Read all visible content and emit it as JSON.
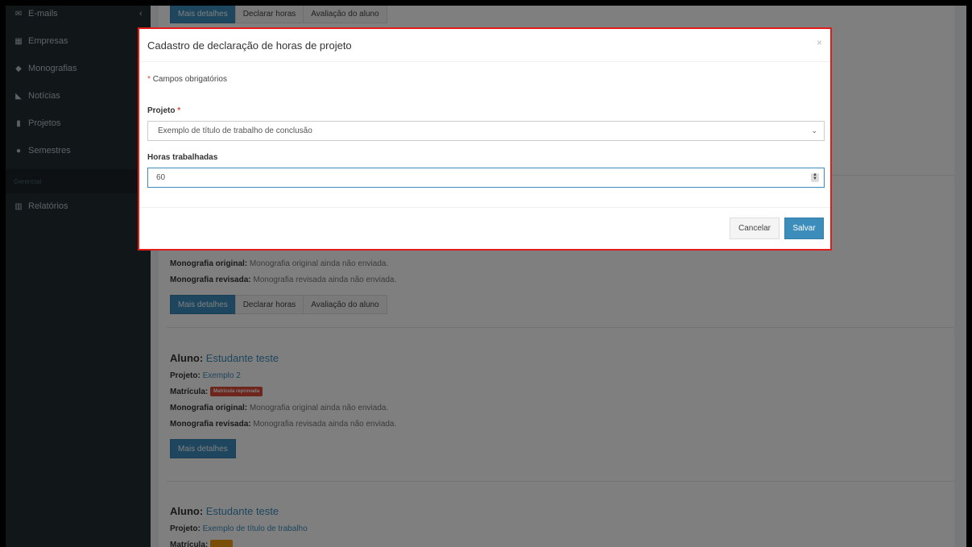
{
  "sidebar": {
    "toggle_icon": "chevron-left-icon",
    "items": [
      {
        "label": "E-mails",
        "icon": "envelope-icon"
      },
      {
        "label": "Empresas",
        "icon": "building-icon"
      },
      {
        "label": "Monografias",
        "icon": "graduation-cap-icon"
      },
      {
        "label": "Notícias",
        "icon": "rss-icon"
      },
      {
        "label": "Projetos",
        "icon": "file-icon"
      },
      {
        "label": "Semestres",
        "icon": "user-icon"
      }
    ],
    "section_header": "Gerencial",
    "report_item": {
      "label": "Relatórios",
      "icon": "bar-chart-icon"
    }
  },
  "background": {
    "top_buttons": [
      "Mais detalhes",
      "Declarar horas",
      "Avaliação do aluno"
    ],
    "card1": {
      "orig_label": "Monografia original:",
      "orig_value": "Monografia original ainda não enviada.",
      "rev_label": "Monografia revisada:",
      "rev_value": "Monografia revisada ainda não enviada.",
      "buttons": [
        "Mais detalhes",
        "Declarar horas",
        "Avaliação do aluno"
      ]
    },
    "card2": {
      "aluno_label": "Aluno:",
      "aluno_value": "Estudante teste",
      "projeto_label": "Projeto:",
      "projeto_value": "Exemplo 2",
      "matricula_label": "Matrícula:",
      "matricula_badge": "Matrícula reprovada",
      "orig_label": "Monografia original:",
      "orig_value": "Monografia original ainda não enviada.",
      "rev_label": "Monografia revisada:",
      "rev_value": "Monografia revisada ainda não enviada.",
      "button": "Mais detalhes"
    },
    "card3": {
      "aluno_label": "Aluno:",
      "aluno_value": "Estudante teste",
      "projeto_label": "Projeto:",
      "projeto_value": "Exemplo de título de trabalho",
      "matricula_label": "Matrícula:"
    }
  },
  "modal": {
    "title": "Cadastro de declaração de horas de projeto",
    "close": "×",
    "required_star": "*",
    "required_note": "Campos obrigatórios",
    "projeto_label": "Projeto",
    "projeto_star": "*",
    "projeto_value": "Exemplo de título de trabalho de conclusão",
    "horas_label": "Horas trabalhadas",
    "horas_value": "60",
    "cancel_label": "Cancelar",
    "save_label": "Salvar"
  },
  "colors": {
    "accent": "#3c8dbc",
    "sidebar": "#222d32",
    "danger": "#dd4b39",
    "highlight_border": "#e41b1b"
  }
}
